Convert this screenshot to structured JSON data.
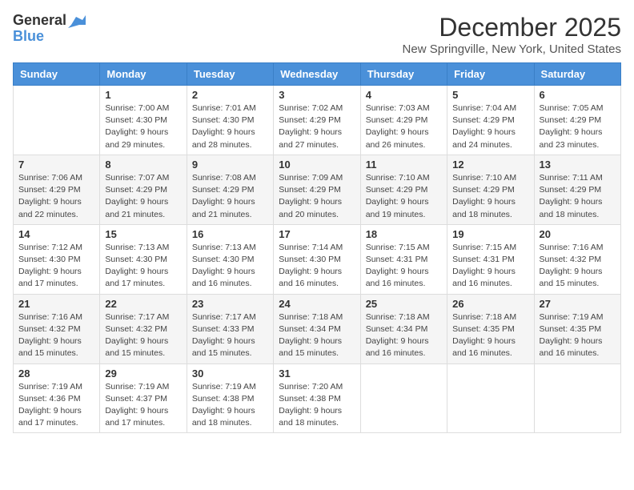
{
  "header": {
    "logo_general": "General",
    "logo_blue": "Blue",
    "month_title": "December 2025",
    "location": "New Springville, New York, United States"
  },
  "weekdays": [
    "Sunday",
    "Monday",
    "Tuesday",
    "Wednesday",
    "Thursday",
    "Friday",
    "Saturday"
  ],
  "weeks": [
    [
      {
        "day": "",
        "info": ""
      },
      {
        "day": "1",
        "info": "Sunrise: 7:00 AM\nSunset: 4:30 PM\nDaylight: 9 hours\nand 29 minutes."
      },
      {
        "day": "2",
        "info": "Sunrise: 7:01 AM\nSunset: 4:30 PM\nDaylight: 9 hours\nand 28 minutes."
      },
      {
        "day": "3",
        "info": "Sunrise: 7:02 AM\nSunset: 4:29 PM\nDaylight: 9 hours\nand 27 minutes."
      },
      {
        "day": "4",
        "info": "Sunrise: 7:03 AM\nSunset: 4:29 PM\nDaylight: 9 hours\nand 26 minutes."
      },
      {
        "day": "5",
        "info": "Sunrise: 7:04 AM\nSunset: 4:29 PM\nDaylight: 9 hours\nand 24 minutes."
      },
      {
        "day": "6",
        "info": "Sunrise: 7:05 AM\nSunset: 4:29 PM\nDaylight: 9 hours\nand 23 minutes."
      }
    ],
    [
      {
        "day": "7",
        "info": "Sunrise: 7:06 AM\nSunset: 4:29 PM\nDaylight: 9 hours\nand 22 minutes."
      },
      {
        "day": "8",
        "info": "Sunrise: 7:07 AM\nSunset: 4:29 PM\nDaylight: 9 hours\nand 21 minutes."
      },
      {
        "day": "9",
        "info": "Sunrise: 7:08 AM\nSunset: 4:29 PM\nDaylight: 9 hours\nand 21 minutes."
      },
      {
        "day": "10",
        "info": "Sunrise: 7:09 AM\nSunset: 4:29 PM\nDaylight: 9 hours\nand 20 minutes."
      },
      {
        "day": "11",
        "info": "Sunrise: 7:10 AM\nSunset: 4:29 PM\nDaylight: 9 hours\nand 19 minutes."
      },
      {
        "day": "12",
        "info": "Sunrise: 7:10 AM\nSunset: 4:29 PM\nDaylight: 9 hours\nand 18 minutes."
      },
      {
        "day": "13",
        "info": "Sunrise: 7:11 AM\nSunset: 4:29 PM\nDaylight: 9 hours\nand 18 minutes."
      }
    ],
    [
      {
        "day": "14",
        "info": "Sunrise: 7:12 AM\nSunset: 4:30 PM\nDaylight: 9 hours\nand 17 minutes."
      },
      {
        "day": "15",
        "info": "Sunrise: 7:13 AM\nSunset: 4:30 PM\nDaylight: 9 hours\nand 17 minutes."
      },
      {
        "day": "16",
        "info": "Sunrise: 7:13 AM\nSunset: 4:30 PM\nDaylight: 9 hours\nand 16 minutes."
      },
      {
        "day": "17",
        "info": "Sunrise: 7:14 AM\nSunset: 4:30 PM\nDaylight: 9 hours\nand 16 minutes."
      },
      {
        "day": "18",
        "info": "Sunrise: 7:15 AM\nSunset: 4:31 PM\nDaylight: 9 hours\nand 16 minutes."
      },
      {
        "day": "19",
        "info": "Sunrise: 7:15 AM\nSunset: 4:31 PM\nDaylight: 9 hours\nand 16 minutes."
      },
      {
        "day": "20",
        "info": "Sunrise: 7:16 AM\nSunset: 4:32 PM\nDaylight: 9 hours\nand 15 minutes."
      }
    ],
    [
      {
        "day": "21",
        "info": "Sunrise: 7:16 AM\nSunset: 4:32 PM\nDaylight: 9 hours\nand 15 minutes."
      },
      {
        "day": "22",
        "info": "Sunrise: 7:17 AM\nSunset: 4:32 PM\nDaylight: 9 hours\nand 15 minutes."
      },
      {
        "day": "23",
        "info": "Sunrise: 7:17 AM\nSunset: 4:33 PM\nDaylight: 9 hours\nand 15 minutes."
      },
      {
        "day": "24",
        "info": "Sunrise: 7:18 AM\nSunset: 4:34 PM\nDaylight: 9 hours\nand 15 minutes."
      },
      {
        "day": "25",
        "info": "Sunrise: 7:18 AM\nSunset: 4:34 PM\nDaylight: 9 hours\nand 16 minutes."
      },
      {
        "day": "26",
        "info": "Sunrise: 7:18 AM\nSunset: 4:35 PM\nDaylight: 9 hours\nand 16 minutes."
      },
      {
        "day": "27",
        "info": "Sunrise: 7:19 AM\nSunset: 4:35 PM\nDaylight: 9 hours\nand 16 minutes."
      }
    ],
    [
      {
        "day": "28",
        "info": "Sunrise: 7:19 AM\nSunset: 4:36 PM\nDaylight: 9 hours\nand 17 minutes."
      },
      {
        "day": "29",
        "info": "Sunrise: 7:19 AM\nSunset: 4:37 PM\nDaylight: 9 hours\nand 17 minutes."
      },
      {
        "day": "30",
        "info": "Sunrise: 7:19 AM\nSunset: 4:38 PM\nDaylight: 9 hours\nand 18 minutes."
      },
      {
        "day": "31",
        "info": "Sunrise: 7:20 AM\nSunset: 4:38 PM\nDaylight: 9 hours\nand 18 minutes."
      },
      {
        "day": "",
        "info": ""
      },
      {
        "day": "",
        "info": ""
      },
      {
        "day": "",
        "info": ""
      }
    ]
  ]
}
